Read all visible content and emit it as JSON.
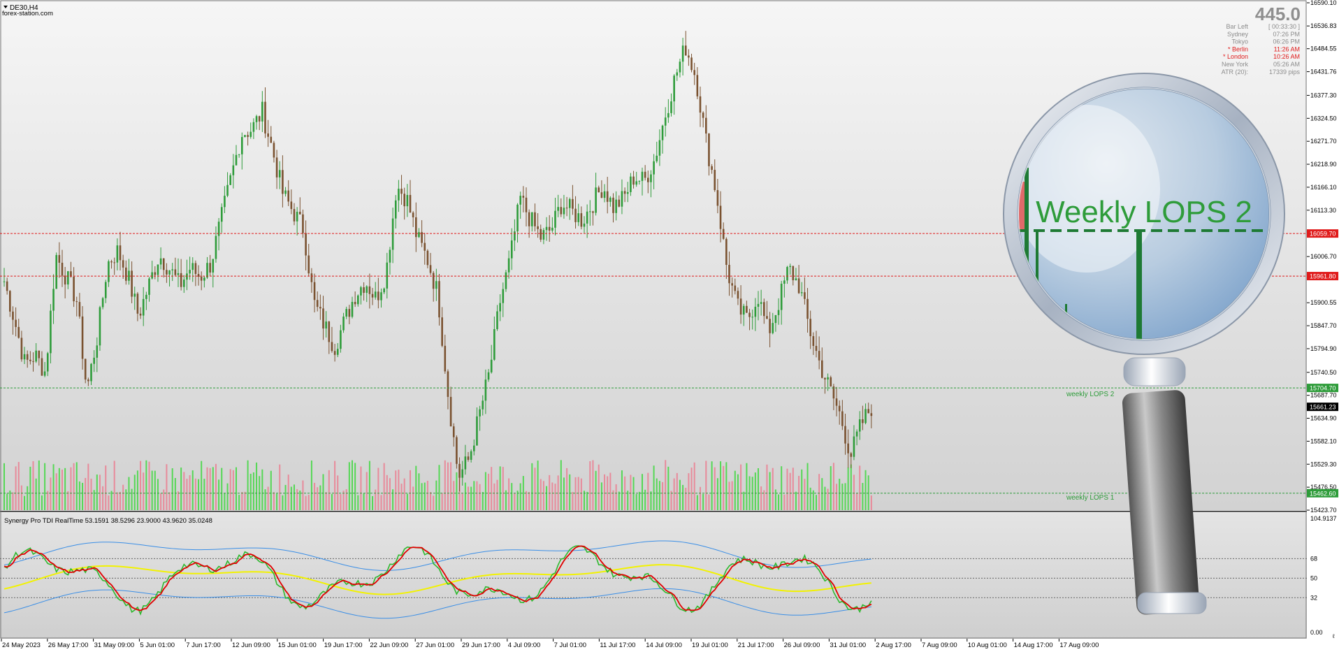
{
  "symbol": "DE30,H4",
  "watermark": "forex-station.com",
  "info_panel": {
    "big_value": "445.0",
    "rows": [
      {
        "label": "Bar Left",
        "value": "[ 00:33:30 ]",
        "color": "#8c8c8c"
      },
      {
        "label": "Sydney",
        "value": "07:26 PM",
        "color": "#8c8c8c"
      },
      {
        "label": "Tokyo",
        "value": "06:26 PM",
        "color": "#8c8c8c"
      },
      {
        "label": "* Berlin",
        "value": "11:26 AM",
        "color": "#e01b1b"
      },
      {
        "label": "* London",
        "value": "10:26 AM",
        "color": "#e01b1b"
      },
      {
        "label": "New York",
        "value": "05:26 AM",
        "color": "#8c8c8c"
      },
      {
        "label": "ATR (20):",
        "value": "17339 pips",
        "color": "#8c8c8c"
      }
    ]
  },
  "price_axis": [
    "16590.10",
    "16536.83",
    "16484.55",
    "16431.76",
    "16377.30",
    "16324.50",
    "16271.70",
    "16218.90",
    "16166.10",
    "16113.30",
    "16006.70",
    "15900.55",
    "15847.70",
    "15794.90",
    "15740.50",
    "15687.70",
    "15634.90",
    "15582.10",
    "15529.30",
    "15476.50",
    "15423.70"
  ],
  "price_tags": [
    {
      "text": "16059.70",
      "bg": "#e01b1b"
    },
    {
      "text": "15961.80",
      "bg": "#e01b1b"
    },
    {
      "text": "15704.70",
      "bg": "#2e9c3a"
    },
    {
      "text": "15661.23",
      "bg": "#000000"
    },
    {
      "text": "15462.60",
      "bg": "#2e9c3a"
    }
  ],
  "level_labels": {
    "lops2": "weekly LOPS 2",
    "lops1": "weekly LOPS 1"
  },
  "magnifier_text": "Weekly LOPS 2",
  "indicator": {
    "title": "Synergy Pro TDI RealTime 53.1591 38.5296 23.9000 43.9620 35.0248",
    "axis": [
      "104.9137",
      "68",
      "50",
      "32",
      "0.00"
    ],
    "axis_suffix": "ℓ"
  },
  "time_axis": [
    "24 May 2023",
    "26 May 17:00",
    "31 May 09:00",
    "5 Jun 01:00",
    "7 Jun 17:00",
    "12 Jun 09:00",
    "15 Jun 01:00",
    "19 Jun 17:00",
    "22 Jun 09:00",
    "27 Jun 01:00",
    "29 Jun 17:00",
    "4 Jul 09:00",
    "7 Jul 01:00",
    "11 Jul 17:00",
    "14 Jul 09:00",
    "19 Jul 01:00",
    "21 Jul 17:00",
    "26 Jul 09:00",
    "31 Jul 01:00",
    "2 Aug 17:00",
    "7 Aug 09:00",
    "10 Aug 01:00",
    "14 Aug 17:00",
    "17 Aug 09:00"
  ],
  "colors": {
    "bull": "#2e9c3a",
    "bear": "#7a5230",
    "vol_up": "#55d755",
    "vol_down": "#e88a9a",
    "tdi_green": "#2eb82e",
    "tdi_red": "#e00000",
    "tdi_yellow": "#f2f200",
    "tdi_band": "#3a8ee6"
  },
  "chart_data": {
    "type": "candlestick",
    "title": "DE30,H4",
    "ylim": [
      15423.7,
      16590.1
    ],
    "levels": [
      16059.7,
      15961.8,
      15704.7,
      15462.6
    ],
    "current_price": 15661.23,
    "close_path": [
      15950,
      15860,
      15760,
      15780,
      15740,
      16010,
      15960,
      15910,
      15700,
      15820,
      15990,
      16020,
      15960,
      15870,
      15940,
      16010,
      15980,
      15940,
      15980,
      15960,
      15990,
      16090,
      16190,
      16290,
      16300,
      16340,
      16250,
      16150,
      16110,
      16070,
      15900,
      15850,
      15800,
      15860,
      15920,
      15950,
      15910,
      15970,
      16170,
      16140,
      16050,
      16000,
      15920,
      15690,
      15500,
      15540,
      15640,
      15740,
      15900,
      16000,
      16140,
      16090,
      16050,
      16070,
      16130,
      16110,
      16090,
      16130,
      16170,
      16120,
      16140,
      16190,
      16180,
      16230,
      16330,
      16420,
      16490,
      16420,
      16270,
      16150,
      15980,
      15890,
      15860,
      15920,
      15830,
      15900,
      15980,
      15940,
      15840,
      15760,
      15700,
      15640,
      15550,
      15620,
      15661
    ]
  }
}
